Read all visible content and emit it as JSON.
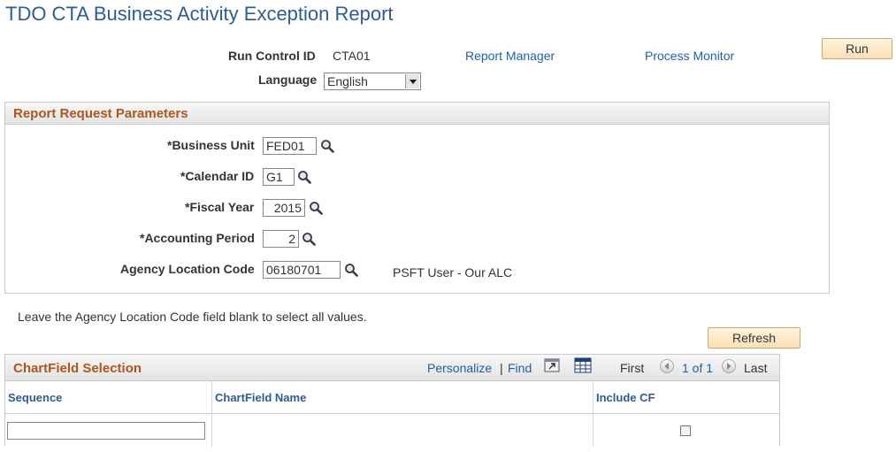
{
  "page_title": "TDO CTA Business Activity Exception Report",
  "run_control": {
    "label": "Run Control ID",
    "value": "CTA01",
    "report_manager_link": "Report Manager",
    "process_monitor_link": "Process Monitor",
    "run_button": "Run",
    "language_label": "Language",
    "language_value": "English"
  },
  "report_params": {
    "section_title": "Report Request Parameters",
    "business_unit_label": "*Business Unit",
    "business_unit_value": "FED01",
    "calendar_id_label": "*Calendar ID",
    "calendar_id_value": "G1",
    "fiscal_year_label": "*Fiscal Year",
    "fiscal_year_value": "2015",
    "accounting_period_label": "*Accounting Period",
    "accounting_period_value": "2",
    "alc_label": "Agency Location Code",
    "alc_value": "06180701",
    "alc_description": "PSFT User - Our ALC"
  },
  "info_note": "Leave the Agency Location Code field blank to select all values.",
  "refresh_button": "Refresh",
  "chartfield_grid": {
    "title": "ChartField Selection",
    "personalize_link": "Personalize",
    "separator": "|",
    "find_link": "Find",
    "first_label": "First",
    "page_range": "1 of 1",
    "last_label": "Last",
    "columns": [
      "Sequence",
      "ChartField Name",
      "Include CF"
    ],
    "rows": [
      {
        "sequence": "",
        "chartfield_name": "",
        "include_cf": false
      }
    ]
  },
  "colors": {
    "title_blue": "#2e5d8f",
    "section_orange": "#b0561c",
    "link_blue": "#1f5fa8",
    "button_fill": "#fbe0b4"
  }
}
